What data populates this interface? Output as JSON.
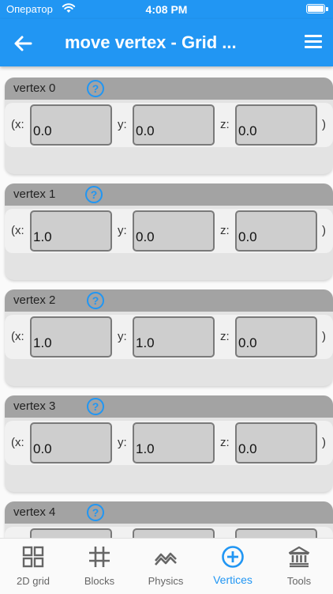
{
  "status_bar": {
    "carrier": "Оператор",
    "time": "4:08 PM"
  },
  "app_bar": {
    "title": "move vertex - Grid ..."
  },
  "vertices": [
    {
      "label": "vertex 0",
      "x": "0.0",
      "y": "0.0",
      "z": "0.0"
    },
    {
      "label": "vertex 1",
      "x": "1.0",
      "y": "0.0",
      "z": "0.0"
    },
    {
      "label": "vertex 2",
      "x": "1.0",
      "y": "1.0",
      "z": "0.0"
    },
    {
      "label": "vertex 3",
      "x": "0.0",
      "y": "1.0",
      "z": "0.0"
    },
    {
      "label": "vertex 4",
      "x": "",
      "y": "",
      "z": ""
    }
  ],
  "coord_labels": {
    "open": "(x:",
    "y": "y:",
    "z": "z:",
    "close": ")"
  },
  "help_symbol": "?",
  "bottom_nav": {
    "items": [
      {
        "label": "2D grid",
        "icon": "grid-icon"
      },
      {
        "label": "Blocks",
        "icon": "hash-icon"
      },
      {
        "label": "Physics",
        "icon": "wave-icon"
      },
      {
        "label": "Vertices",
        "icon": "add-circle-icon",
        "active": true
      },
      {
        "label": "Tools",
        "icon": "bank-icon"
      }
    ]
  },
  "colors": {
    "primary": "#2196f3",
    "card": "#e3e3e3",
    "card_header": "#a3a3a3",
    "field": "#cecece"
  }
}
